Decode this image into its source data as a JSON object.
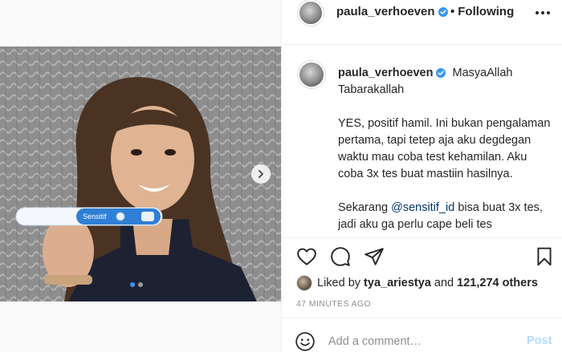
{
  "post": {
    "username": "paula_verhoeven",
    "follow_status": "Following",
    "follow_separator": "•",
    "verified": true
  },
  "caption": {
    "username": "paula_verhoeven",
    "first_line": "MasyaAllah Tabarakallah",
    "paragraph_1": "YES, positif hamil. Ini bukan pengalaman pertama, tapi tetep aja aku degdegan waktu mau coba test kehamilan. Aku coba 3x tes buat mastiin hasilnya.",
    "paragraph_2_before": "Sekarang ",
    "paragraph_2_mention": "@sensitif_id",
    "paragraph_2_after": " bisa buat 3x tes, jadi aku ga perlu cape beli tes"
  },
  "media": {
    "product_label": "Sensitif",
    "carousel_dots": 2,
    "active_dot": 1
  },
  "likes": {
    "prefix": "Liked by",
    "liker": "tya_ariestya",
    "connector": "and",
    "others": "121,274 others"
  },
  "timestamp": "47 MINUTES AGO",
  "comment": {
    "placeholder": "Add a comment…",
    "post_label": "Post"
  },
  "icons": {
    "like": "heart-icon",
    "comment": "comment-icon",
    "share": "paper-plane-icon",
    "save": "bookmark-icon",
    "emoji": "smiley-icon",
    "more": "more-options-icon",
    "next": "chevron-right-icon"
  },
  "colors": {
    "verified_blue": "#3897f0",
    "mention_blue": "#00376b",
    "post_button_disabled": "#b3dbff",
    "muted_text": "#8e8e8e"
  }
}
